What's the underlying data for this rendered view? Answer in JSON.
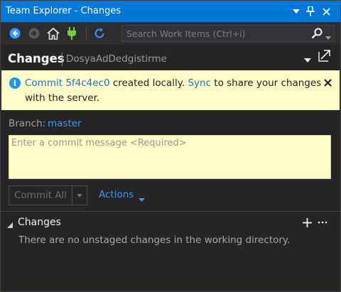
{
  "window": {
    "title": "Team Explorer - Changes"
  },
  "toolbar": {
    "search_placeholder": "Search Work Items (Ctrl+i)"
  },
  "header": {
    "page_title": "Changes",
    "repo_name": "DosyaAdDedgistirme"
  },
  "infobar": {
    "commit_link": "Commit 5f4c4ec0",
    "text_after_commit": " created locally. ",
    "sync_link": "Sync",
    "text_after_sync": " to share your changes",
    "line2": "with the server."
  },
  "branch": {
    "label": "Branch:",
    "value": "master"
  },
  "commit": {
    "message_placeholder": "Enter a commit message <Required>",
    "button_label": "Commit All",
    "actions_label": "Actions"
  },
  "changes_section": {
    "title": "Changes",
    "empty_message": "There are no unstaged changes in the working directory."
  },
  "colors": {
    "title_bar": "#0078d7",
    "accent_link": "#3399ff",
    "info_bar_bg": "#fdfbc8",
    "panel_bg": "#252526"
  },
  "icons": {
    "back": "back-arrow-icon",
    "forward": "forward-arrow-icon",
    "home": "home-icon",
    "connect": "plug-icon",
    "refresh": "refresh-icon",
    "search": "search-icon",
    "info": "info-icon",
    "close": "close-icon",
    "dropdown": "dropdown-arrow-icon",
    "pin": "pin-icon",
    "navigate": "navigate-arrow-icon",
    "add": "plus-icon",
    "more": "ellipsis-icon"
  }
}
